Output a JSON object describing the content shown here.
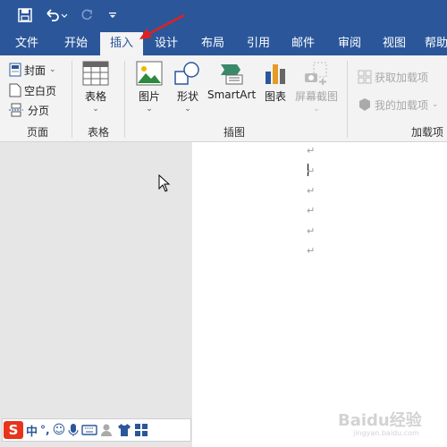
{
  "quick_access": {
    "save_icon": "save-icon",
    "undo_icon": "undo-icon",
    "redo_icon": "redo-icon",
    "customize_icon": "customize-qat-icon"
  },
  "tabs": [
    {
      "label": "文件"
    },
    {
      "label": "开始"
    },
    {
      "label": "插入"
    },
    {
      "label": "设计"
    },
    {
      "label": "布局"
    },
    {
      "label": "引用"
    },
    {
      "label": "邮件"
    },
    {
      "label": "审阅"
    },
    {
      "label": "视图"
    },
    {
      "label": "帮助"
    }
  ],
  "ribbon": {
    "pages": {
      "label": "页面",
      "cover": "封面",
      "blank_page": "空白页",
      "page_break": "分页"
    },
    "tables": {
      "label": "表格",
      "table": "表格"
    },
    "illustrations": {
      "label": "插图",
      "picture": "图片",
      "shapes": "形状",
      "smartart": "SmartArt",
      "chart": "图表",
      "screenshot": "屏幕截图"
    },
    "addins": {
      "label": "加载项",
      "get_addins": "获取加载项",
      "my_addins": "我的加载项"
    }
  },
  "document": {
    "paragraph_marks": [
      "↵",
      "↵",
      "↵",
      "↵",
      "↵",
      "↵"
    ]
  },
  "ime": {
    "mode": "中",
    "punct": "°,"
  },
  "watermark": {
    "text": "Baidu经验",
    "sub": "jingyan.baidu.com"
  },
  "colors": {
    "word_blue": "#2b579a",
    "ribbon_bg": "#f3f3f3",
    "arrow_red": "#e02020"
  }
}
